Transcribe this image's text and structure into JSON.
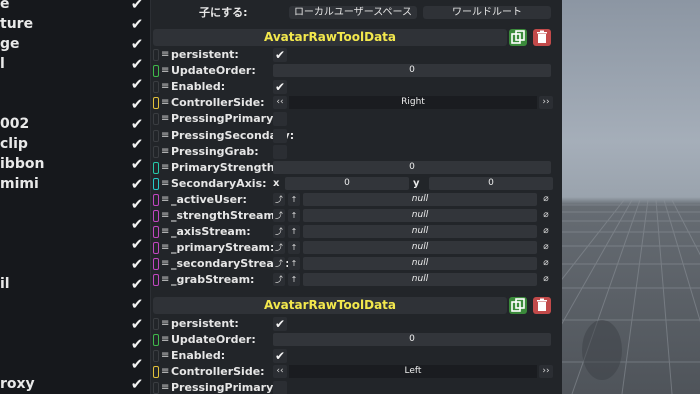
{
  "left_list": [
    {
      "label": "e"
    },
    {
      "label": "ture"
    },
    {
      "label": "ge"
    },
    {
      "label": "l"
    },
    {
      "label": ""
    },
    {
      "label": ""
    },
    {
      "label": "002"
    },
    {
      "label": "clip"
    },
    {
      "label": "ibbon"
    },
    {
      "label": "mimi"
    },
    {
      "label": ""
    },
    {
      "label": ""
    },
    {
      "label": ""
    },
    {
      "label": ""
    },
    {
      "label": "il"
    },
    {
      "label": ""
    },
    {
      "label": ""
    },
    {
      "label": ""
    },
    {
      "label": ""
    },
    {
      "label": "roxy"
    }
  ],
  "top_row": {
    "label": "子にする:",
    "local_btn": "ローカルユーザースペース",
    "world_btn": "ワールドルート"
  },
  "component1": {
    "title": "AvatarRawToolData",
    "fields": {
      "persistent": {
        "label": "persistent:",
        "value": "✔"
      },
      "update_order": {
        "label": "UpdateOrder:",
        "value": "0"
      },
      "enabled": {
        "label": "Enabled:",
        "value": "✔"
      },
      "controller_side": {
        "label": "ControllerSide:",
        "value": "Right"
      },
      "pressing_primary": {
        "label": "PressingPrimary:",
        "value": ""
      },
      "pressing_secondary": {
        "label": "PressingSecondary:",
        "value": ""
      },
      "pressing_grab": {
        "label": "PressingGrab:",
        "value": ""
      },
      "primary_strength": {
        "label": "PrimaryStrength:",
        "value": "0"
      },
      "secondary_axis": {
        "label": "SecondaryAxis:",
        "x_label": "x",
        "x_value": "0",
        "y_label": "y",
        "y_value": "0"
      },
      "active_user": {
        "label": "_activeUser:",
        "value": "null"
      },
      "strength_stream": {
        "label": "_strengthStream:",
        "value": "null"
      },
      "axis_stream": {
        "label": "_axisStream:",
        "value": "null"
      },
      "primary_stream": {
        "label": "_primaryStream:",
        "value": "null"
      },
      "secondary_stream": {
        "label": "_secondaryStream:",
        "value": "null"
      },
      "grab_stream": {
        "label": "_grabStream:",
        "value": "null"
      }
    }
  },
  "component2": {
    "title": "AvatarRawToolData",
    "fields": {
      "persistent": {
        "label": "persistent:",
        "value": "✔"
      },
      "update_order": {
        "label": "UpdateOrder:",
        "value": "0"
      },
      "enabled": {
        "label": "Enabled:",
        "value": "✔"
      },
      "controller_side": {
        "label": "ControllerSide:",
        "value": "Left"
      },
      "pressing_primary": {
        "label": "PressingPrimary:",
        "value": ""
      }
    }
  },
  "glyphs": {
    "grip": "≡",
    "prev": "‹‹",
    "next": "››",
    "ref_drive": "⤴",
    "ref_up": "↑",
    "clear": "⌀",
    "check": "✔"
  },
  "colors": {
    "title_yellow": "#f3e84d",
    "duplicate_green": "#3b8a3b",
    "delete_red": "#c24a4a",
    "pill_bool": "#3a3d41",
    "pill_int": "#3fb94a",
    "pill_enum": "#e1c03a",
    "pill_float": "#26c8a8",
    "pill_float2": "#26c8c8",
    "pill_ref": "#c046c0"
  }
}
